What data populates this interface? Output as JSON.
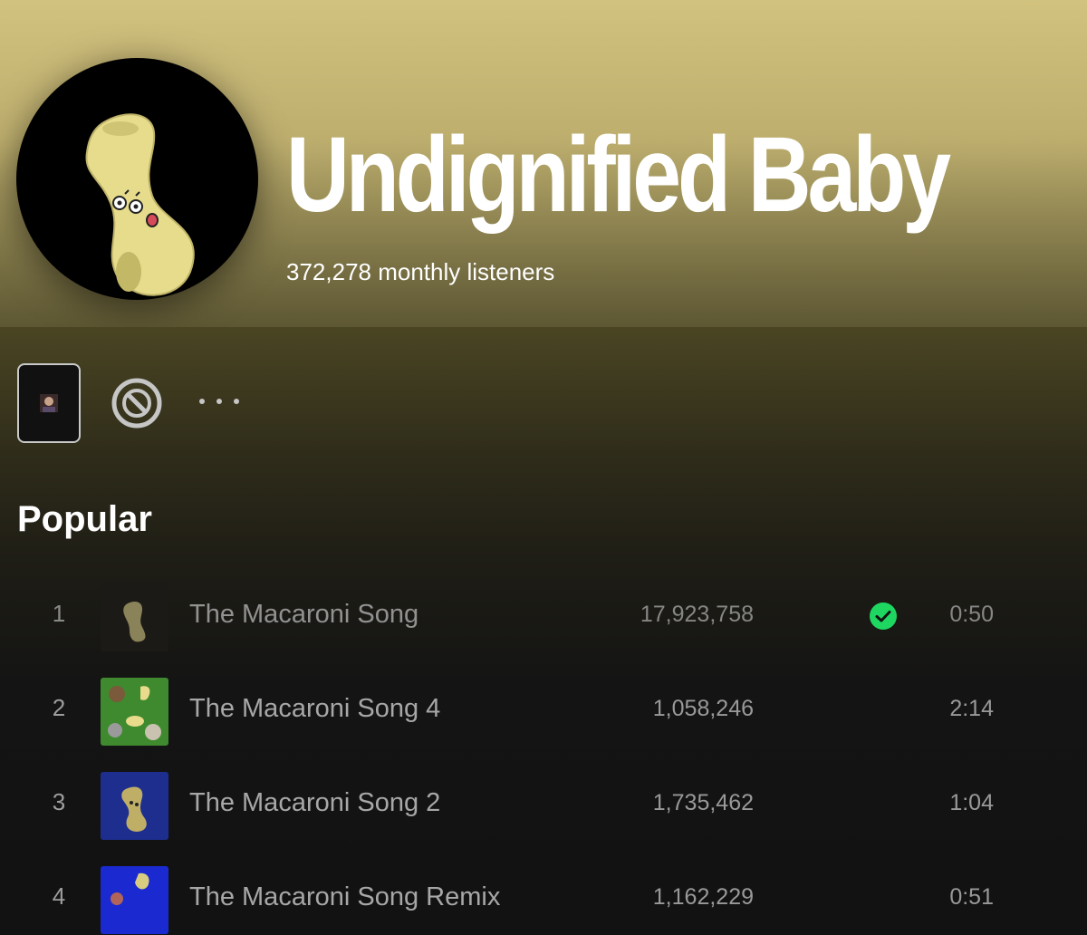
{
  "artist": {
    "name": "Undignified Baby",
    "monthly_listeners": "372,278 monthly listeners"
  },
  "actions": {
    "preview_icon": "artist-preview-icon",
    "block_icon": "block-icon",
    "more_icon": "more-icon"
  },
  "popular": {
    "title": "Popular",
    "tracks": [
      {
        "number": "1",
        "title": "The Macaroni Song",
        "plays": "17,923,758",
        "saved": true,
        "duration": "0:50",
        "cover": "cover-macaroni-dark"
      },
      {
        "number": "2",
        "title": "The Macaroni Song 4",
        "plays": "1,058,246",
        "saved": false,
        "duration": "2:14",
        "cover": "cover-macaroni-green"
      },
      {
        "number": "3",
        "title": "The Macaroni Song 2",
        "plays": "1,735,462",
        "saved": false,
        "duration": "1:04",
        "cover": "cover-macaroni-blue"
      },
      {
        "number": "4",
        "title": "The Macaroni Song Remix",
        "plays": "1,162,229",
        "saved": false,
        "duration": "0:51",
        "cover": "cover-macaroni-remix"
      }
    ]
  },
  "colors": {
    "header_gradient_top": "#d2c27f",
    "saved_check": "#1ed760",
    "background": "#121212"
  }
}
